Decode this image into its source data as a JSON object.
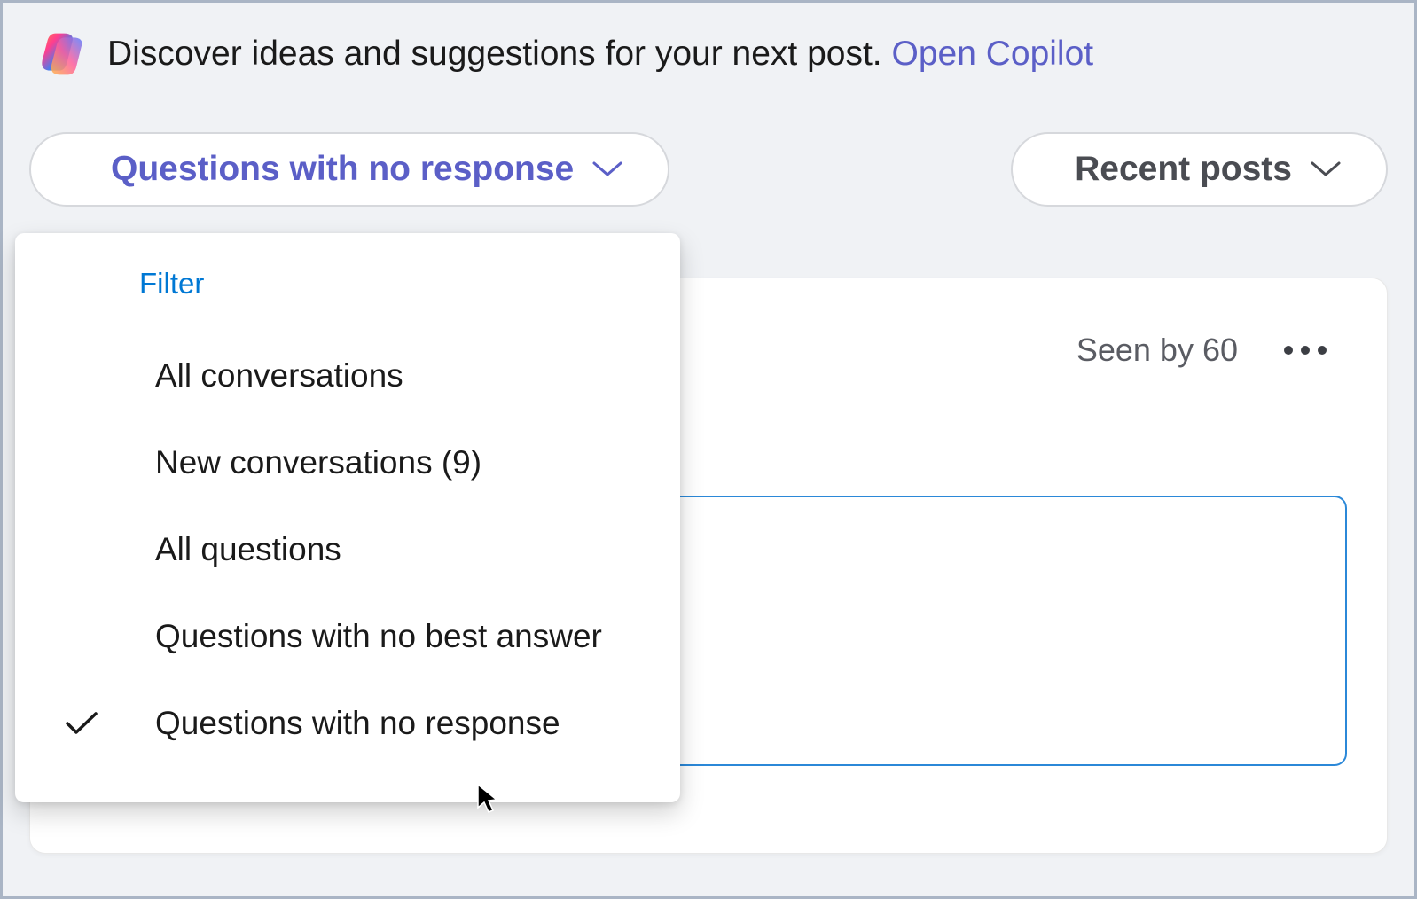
{
  "banner": {
    "text": "Discover ideas and suggestions for your next post. ",
    "link_text": "Open Copilot"
  },
  "filters": {
    "left_dropdown_label": "Questions with no response",
    "right_dropdown_label": "Recent posts"
  },
  "dropdown": {
    "header": "Filter",
    "items": [
      {
        "label": "All conversations",
        "selected": false
      },
      {
        "label": "New conversations (9)",
        "selected": false
      },
      {
        "label": "All questions",
        "selected": false
      },
      {
        "label": "Questions with no best answer",
        "selected": false
      },
      {
        "label": "Questions with no response",
        "selected": true
      }
    ]
  },
  "post": {
    "seen_by": "Seen by 60"
  }
}
